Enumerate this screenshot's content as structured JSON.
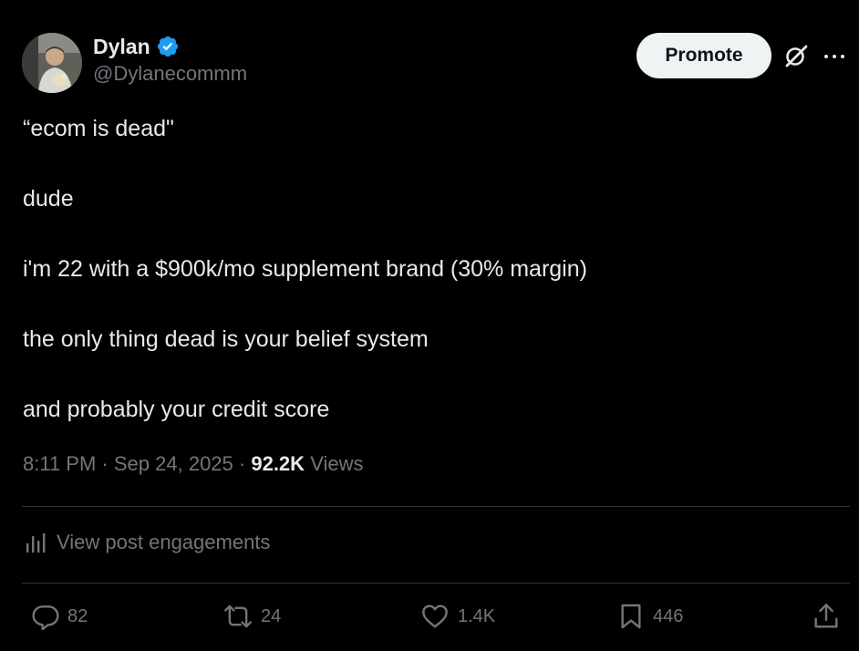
{
  "author": {
    "display_name": "Dylan",
    "handle": "@Dylanecommm",
    "verified": true
  },
  "header": {
    "promote_label": "Promote",
    "grok_icon": "grok-icon",
    "more_icon": "more-icon"
  },
  "post": {
    "lines": [
      "“ecom is dead\"",
      "dude",
      "i'm 22 with a $900k/mo supplement brand (30% margin)",
      "the only thing dead is your belief system",
      "and probably your credit score"
    ]
  },
  "meta": {
    "time": "8:11 PM",
    "date": "Sep 24, 2025",
    "views_count": "92.2K",
    "views_label": "Views"
  },
  "engagements": {
    "label": "View post engagements"
  },
  "actions": {
    "replies": "82",
    "reposts": "24",
    "likes": "1.4K",
    "bookmarks": "446"
  },
  "colors": {
    "background": "#000000",
    "text": "#e7e9ea",
    "secondary": "#71767b",
    "verified": "#1d9bf0",
    "divider": "#2f3336"
  }
}
